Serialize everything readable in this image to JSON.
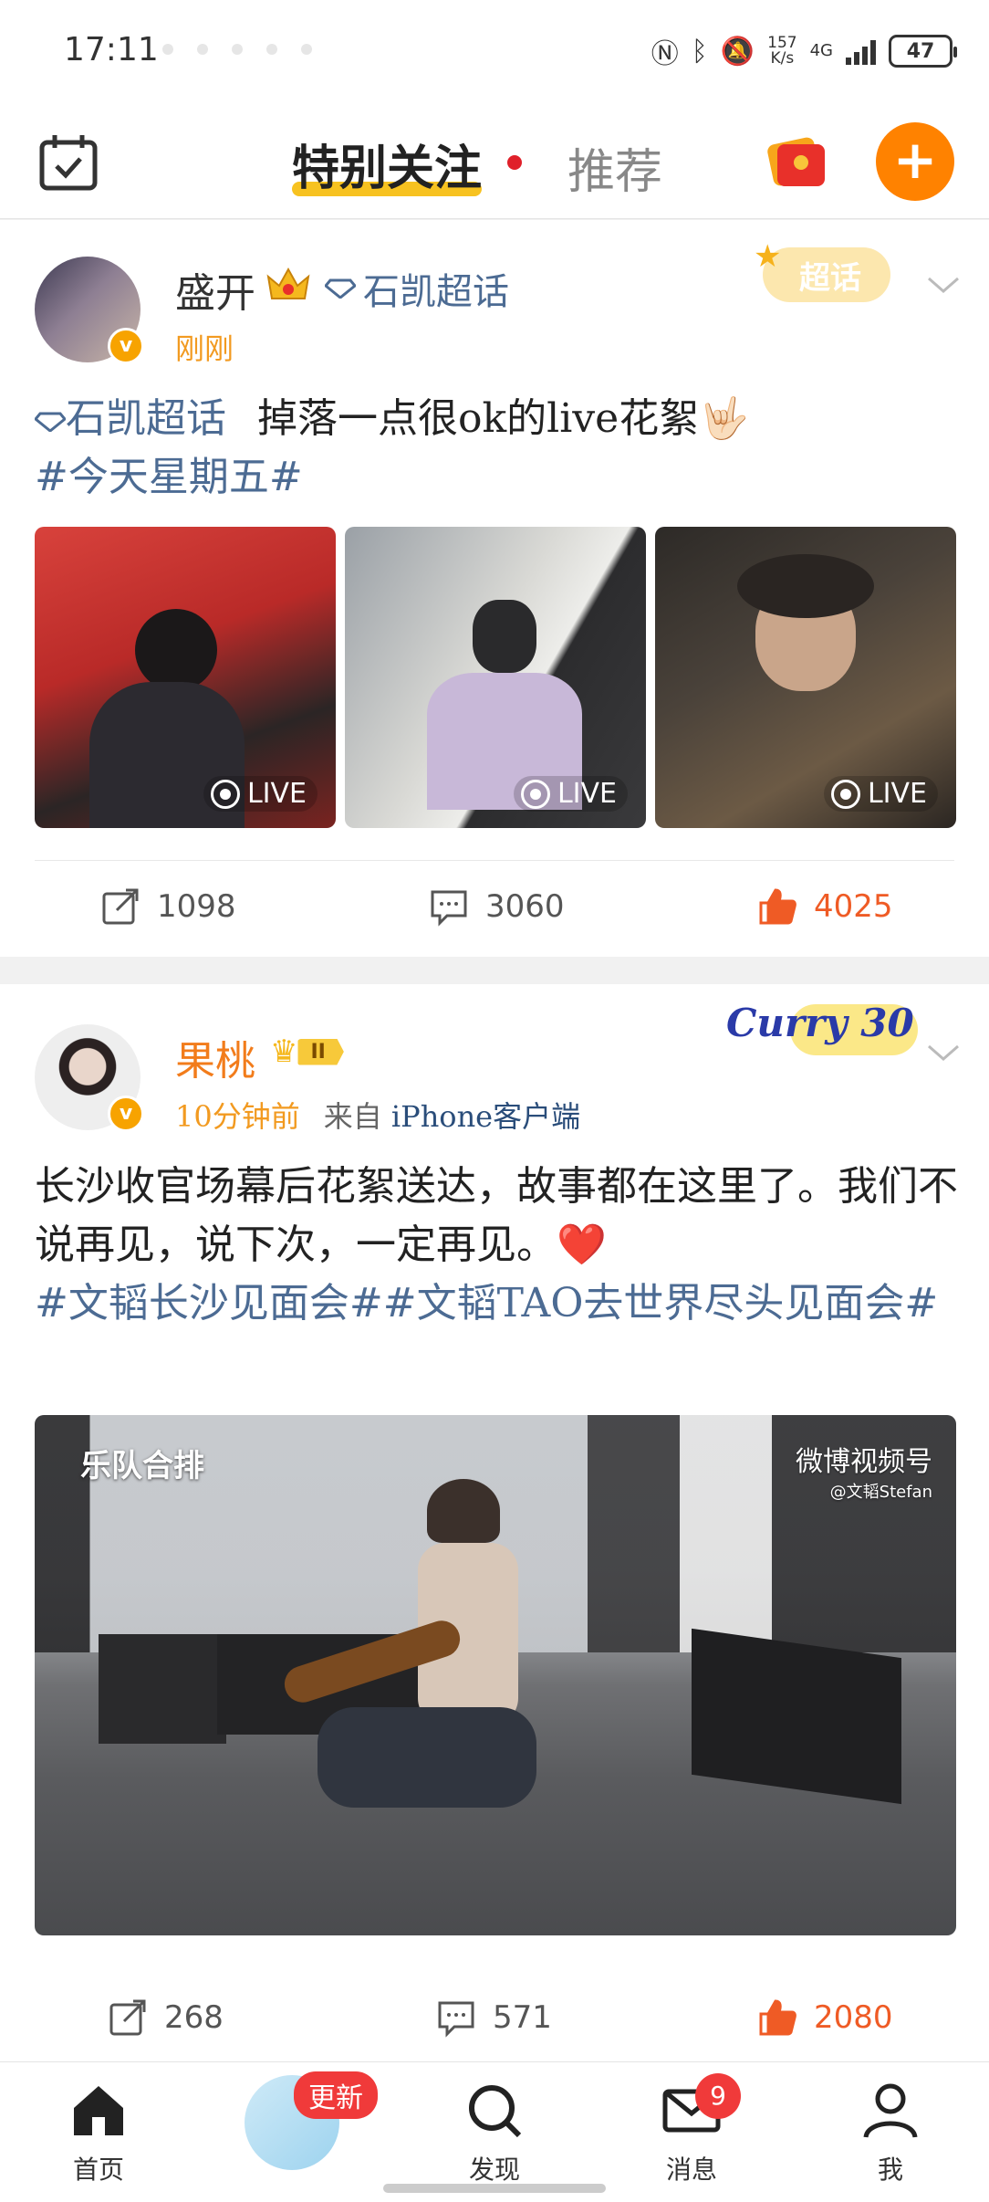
{
  "status_bar": {
    "time": "17:11",
    "speed": "157",
    "speed_unit": "K/s",
    "network": "4G",
    "battery": "47"
  },
  "top_nav": {
    "tab_following": "特别关注",
    "tab_recommend": "推荐",
    "accent_color": "#ff8200"
  },
  "posts": [
    {
      "username": "盛开",
      "supertopic": "石凯超话",
      "badge": "超话",
      "time": "刚刚",
      "body_topic": "石凯超话",
      "body_text": "掉落一点很ok的live花絮🤟🏻",
      "hashtag": "#今天星期五#",
      "images": [
        {
          "live_label": "LIVE"
        },
        {
          "live_label": "LIVE"
        },
        {
          "live_label": "LIVE"
        }
      ],
      "reposts": "1098",
      "comments": "3060",
      "likes": "4025"
    },
    {
      "username": "果桃",
      "level_badge": "II",
      "badge_image_text": "Curry 30",
      "time": "10分钟前",
      "source_prefix": "来自",
      "source": "iPhone客户端",
      "body_text": "长沙收官场幕后花絮送达，故事都在这里了。我们不说再见，说下次，一定再见。❤️",
      "hashtags": "#文韬长沙见面会##文韬TAO去世界尽头见面会#",
      "video_caption": "乐队合排",
      "video_watermark": "微博视频号",
      "video_watermark_sub": "@文韬Stefan",
      "reposts": "268",
      "comments": "571",
      "likes": "2080"
    }
  ],
  "bottom_nav": {
    "home": "首页",
    "update_badge": "更新",
    "discover": "发现",
    "messages": "消息",
    "message_count": "9",
    "me": "我"
  }
}
